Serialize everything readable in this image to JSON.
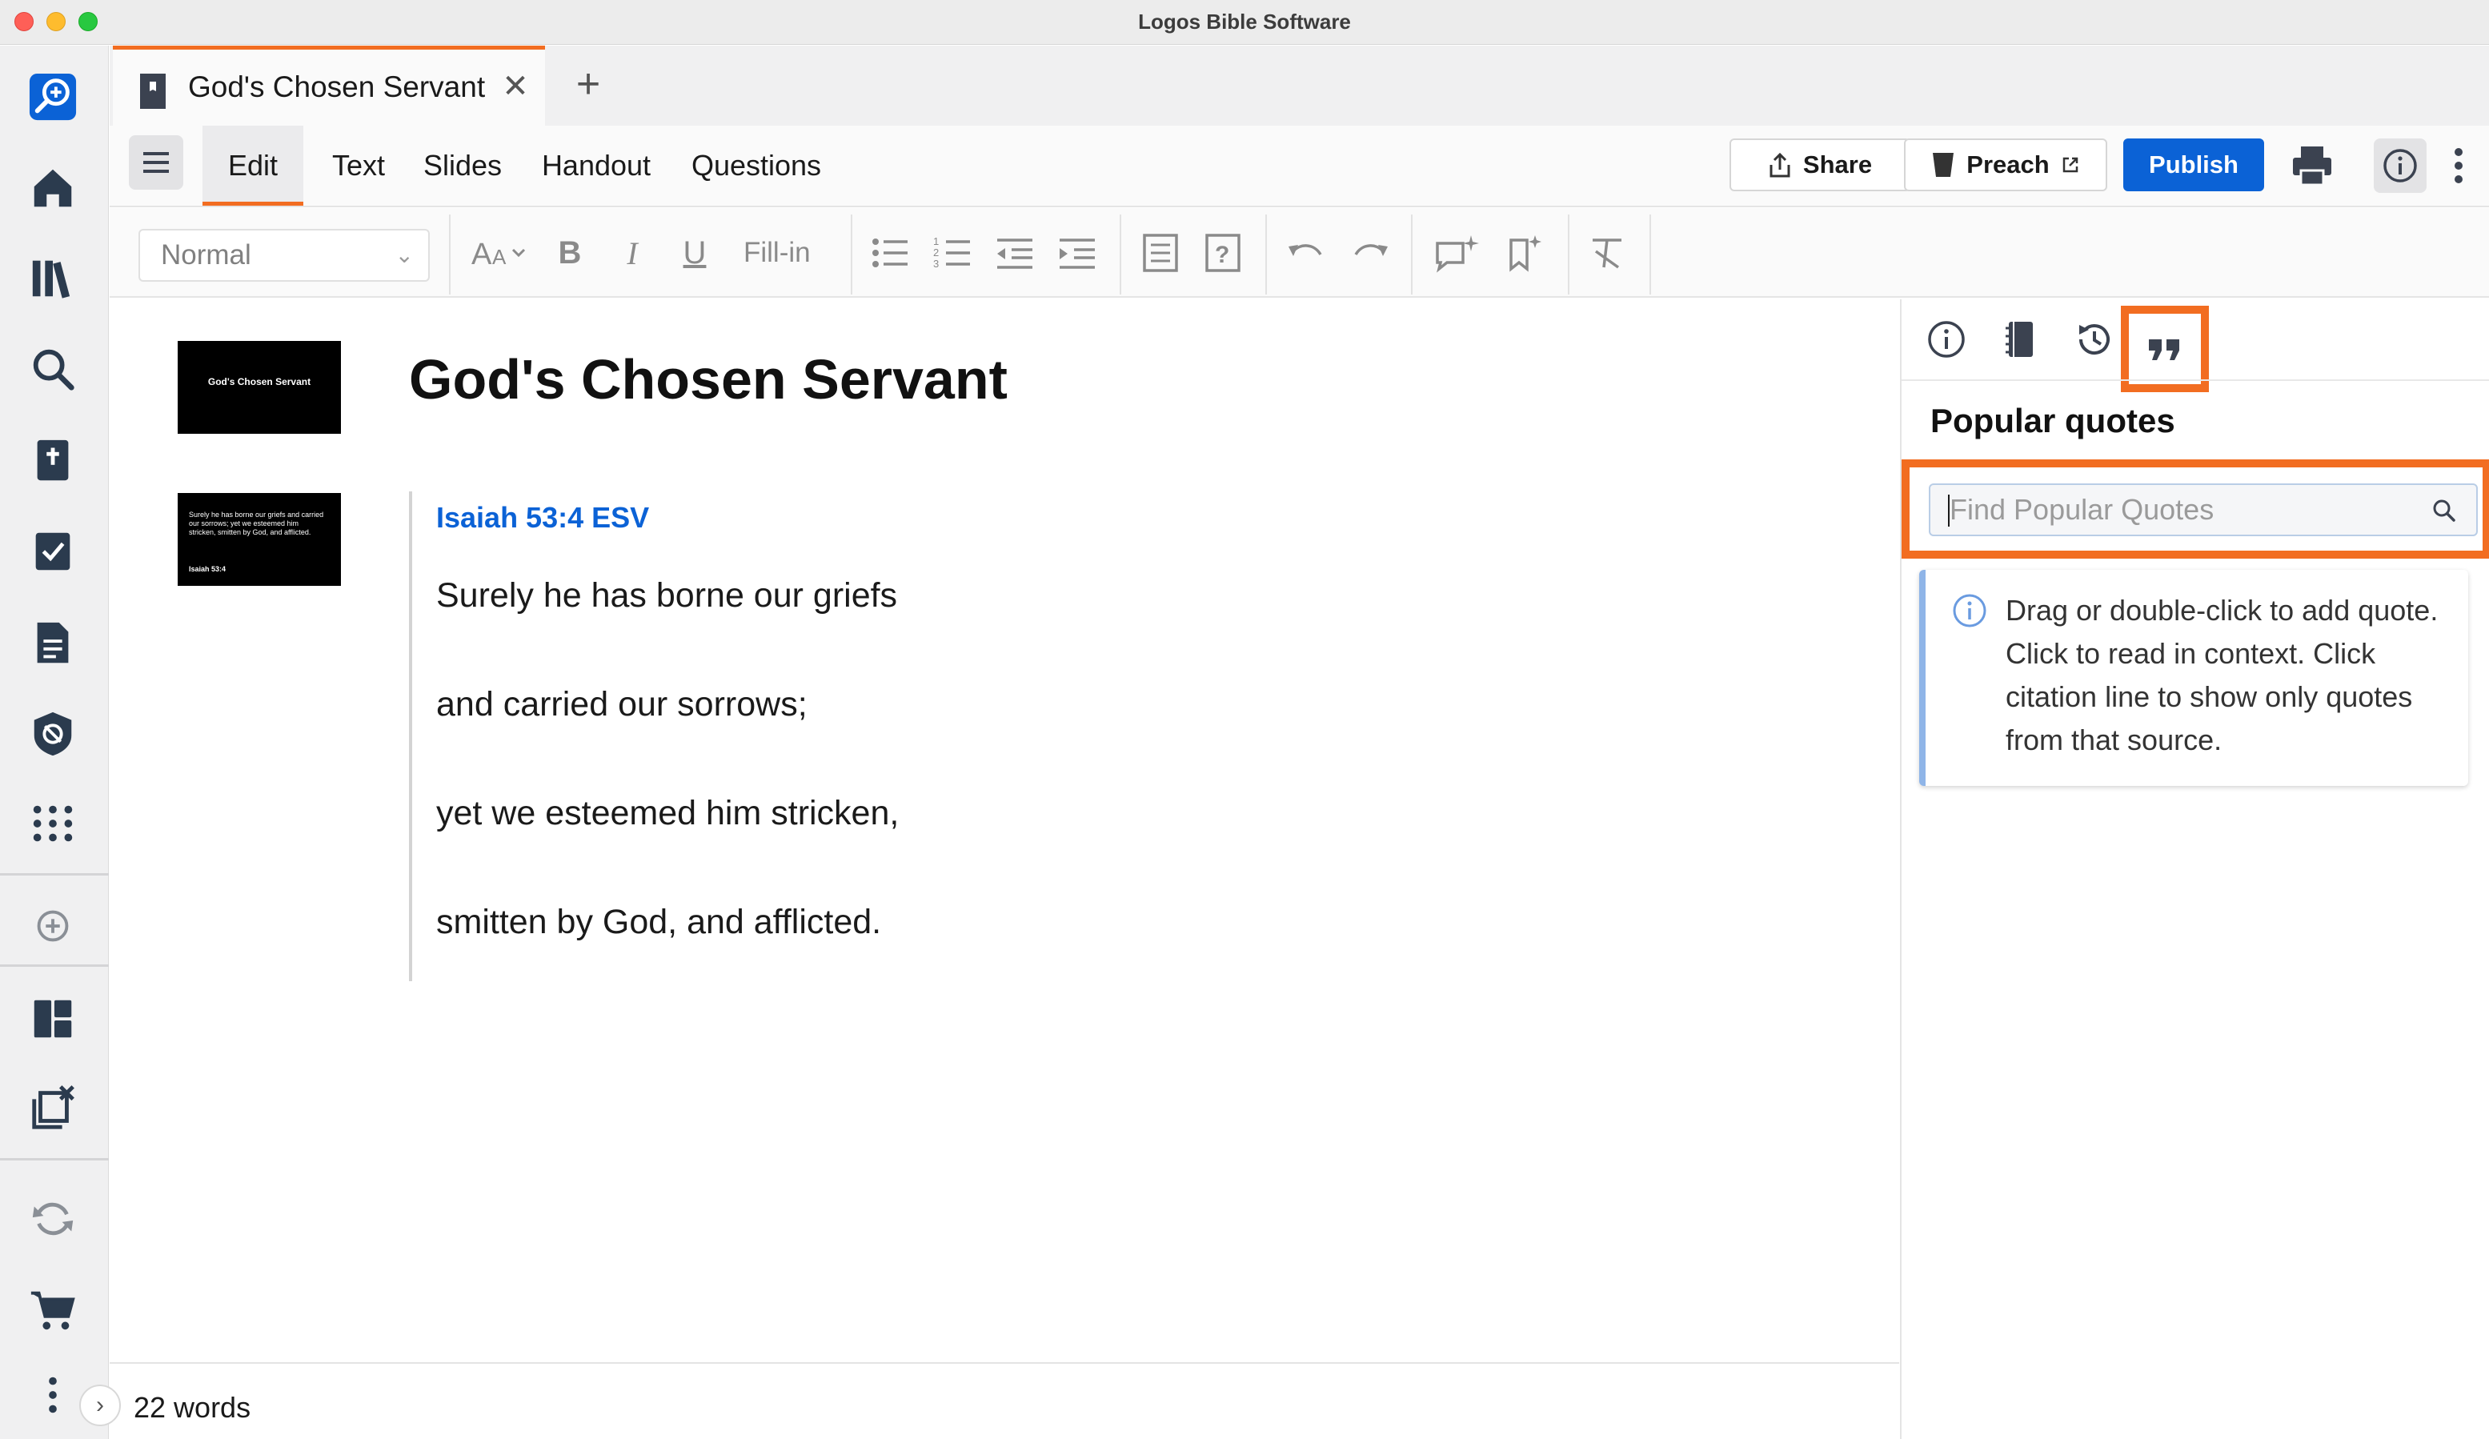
{
  "window": {
    "title": "Logos Bible Software"
  },
  "tab": {
    "label": "God's Chosen Servant",
    "close": "✕",
    "new_tab": "+"
  },
  "modes": {
    "edit": "Edit",
    "text": "Text",
    "slides": "Slides",
    "handout": "Handout",
    "questions": "Questions"
  },
  "header_buttons": {
    "share": "Share",
    "preach": "Preach",
    "publish": "Publish"
  },
  "format_toolbar": {
    "style_value": "Normal",
    "fill_in": "Fill-in",
    "bold": "B",
    "italic": "I",
    "underline": "U"
  },
  "document": {
    "title": "God's Chosen Servant",
    "verse_reference": "Isaiah 53:4 ESV",
    "verse_lines": [
      "Surely he has borne our griefs",
      "and carried our sorrows;",
      "yet we esteemed him stricken,",
      "smitten by God, and afflicted."
    ],
    "word_count": "22 words"
  },
  "slides": {
    "title_slide": "God's Chosen Servant",
    "verse_slide_text": "Surely he has borne our griefs and carried our sorrows; yet we esteemed him stricken, smitten by God, and afflicted.",
    "verse_slide_ref": "Isaiah 53:4"
  },
  "right_panel": {
    "heading": "Popular quotes",
    "search_placeholder": "Find Popular Quotes",
    "info_text": "Drag or double-click to add quote. Click to read in context. Click citation line to show only quotes from that source."
  },
  "colors": {
    "accent_orange": "#f26d21",
    "publish_blue": "#0b62d6",
    "link_blue": "#0b62d6"
  }
}
